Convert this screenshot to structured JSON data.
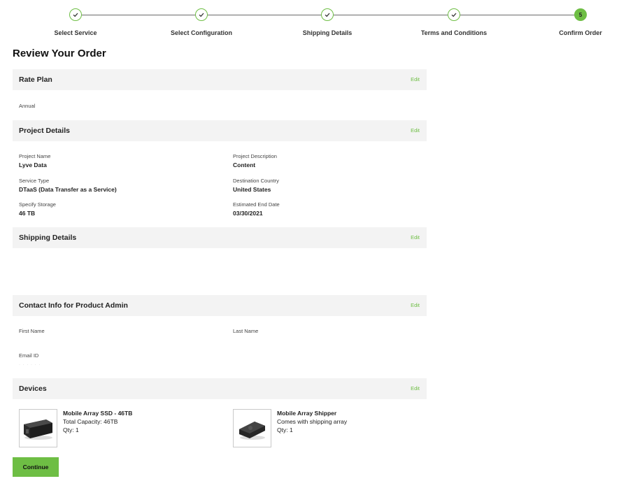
{
  "stepper": {
    "steps": [
      {
        "label": "Select Service",
        "state": "complete",
        "icon": "check-icon"
      },
      {
        "label": "Select Configuration",
        "state": "complete",
        "icon": "check-icon"
      },
      {
        "label": "Shipping Details",
        "state": "complete",
        "icon": "check-icon"
      },
      {
        "label": "Terms and Conditions",
        "state": "complete",
        "icon": "check-icon"
      },
      {
        "label": "Confirm Order",
        "state": "active",
        "number": "5"
      }
    ]
  },
  "page": {
    "title": "Review Your Order"
  },
  "edit_label": "Edit",
  "rate_plan": {
    "title": "Rate Plan",
    "value": "Annual"
  },
  "project_details": {
    "title": "Project Details",
    "project_name": {
      "label": "Project Name",
      "value": "Lyve Data"
    },
    "project_description": {
      "label": "Project Description",
      "value": "Content"
    },
    "service_type": {
      "label": "Service Type",
      "value": "DTaaS (Data Transfer as a Service)"
    },
    "destination_country": {
      "label": "Destination Country",
      "value": "United States"
    },
    "specify_storage": {
      "label": "Specify Storage",
      "value": "46 TB"
    },
    "estimated_end_date": {
      "label": "Estimated End Date",
      "value": "03/30/2021"
    }
  },
  "shipping_details": {
    "title": "Shipping Details"
  },
  "contact_info": {
    "title": "Contact Info for Product Admin",
    "first_name_label": "First Name",
    "last_name_label": "Last Name",
    "email_label": "Email ID",
    "email_value": "· · · · · ·"
  },
  "devices": {
    "title": "Devices",
    "items": [
      {
        "name": "Mobile Array SSD - 46TB",
        "line1": "Total Capacity: 46TB",
        "qty": "Qty: 1"
      },
      {
        "name": "Mobile Array Shipper",
        "line1": "Comes with shipping array",
        "qty": "Qty: 1"
      }
    ]
  },
  "continue_label": "Continue",
  "colors": {
    "accent": "#6ebe44",
    "section_bg": "#f3f3f3"
  }
}
